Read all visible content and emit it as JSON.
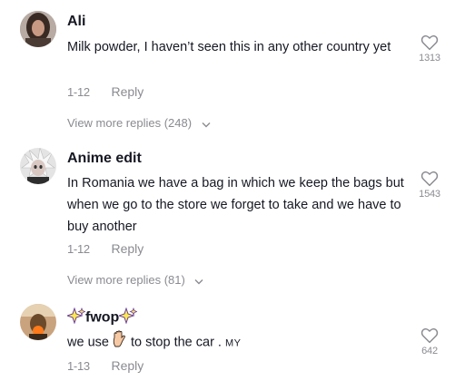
{
  "comments": [
    {
      "author": "Ali",
      "text": "Milk powder, I haven’t seen this in any other country yet",
      "date": "1-12",
      "reply_label": "Reply",
      "likes": "1313",
      "view_more": "View more replies (248)",
      "avatar_icon": "profile-photo-woman-dark-hair"
    },
    {
      "author": "Anime edit",
      "text": "In Romania we have a bag in which we keep the bags but when we go to the store we forget to take and we have to buy another",
      "date": "1-12",
      "reply_label": "Reply",
      "likes": "1543",
      "view_more": "View more replies (81)",
      "avatar_icon": "profile-photo-anime-white-hair"
    },
    {
      "author_name": "fwop",
      "author_emoji": "sparkles-icon",
      "text_before": "we use",
      "text_emoji": "raised-hand-icon",
      "text_after": "to stop the car .",
      "text_suffix": "MY",
      "date": "1-13",
      "reply_label": "Reply",
      "likes": "642",
      "avatar_icon": "profile-photo-orange-scene"
    }
  ],
  "colors": {
    "text_primary": "#161823",
    "text_secondary": "#8a8b91",
    "sparkle_fill": "#fce94f",
    "sparkle_stroke": "#6b3fa0",
    "hand_fill": "#f6c9a5"
  }
}
